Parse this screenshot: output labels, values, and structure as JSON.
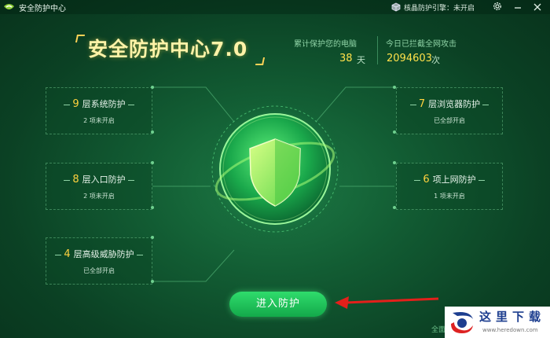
{
  "window": {
    "title": "安全防护中心",
    "engine_status": "核晶防护引擎：未开启",
    "settings_icon": "gear-icon",
    "minimize_icon": "minimize-icon",
    "close_icon": "close-icon"
  },
  "header": {
    "headline": "安全防护中心7.0",
    "days_label": "累计保护您的电脑",
    "days_value": "38",
    "days_unit": "天",
    "attacks_label": "今日已拦截全网攻击",
    "attacks_value": "2094603",
    "attacks_unit": "次"
  },
  "panels": {
    "system": {
      "num": "9",
      "label": "层系统防护",
      "status": "2 项未开启"
    },
    "entry": {
      "num": "8",
      "label": "层入口防护",
      "status": "2 项未开启"
    },
    "threat": {
      "num": "4",
      "label": "层高级威胁防护",
      "status": "已全部开启"
    },
    "browser": {
      "num": "7",
      "label": "层浏览器防护",
      "status": "已全部开启"
    },
    "network": {
      "num": "6",
      "label": "项上网防护",
      "status": "1 项未开启"
    }
  },
  "action": {
    "enter_label": "进入防护"
  },
  "footer": {
    "partial_text": "全面"
  },
  "watermark": {
    "title": "这里下载",
    "url": "www.heredown.com"
  },
  "colors": {
    "accent_yellow": "#ffd23f",
    "button_green": "#22c95c",
    "bg_green": "#125c33"
  }
}
